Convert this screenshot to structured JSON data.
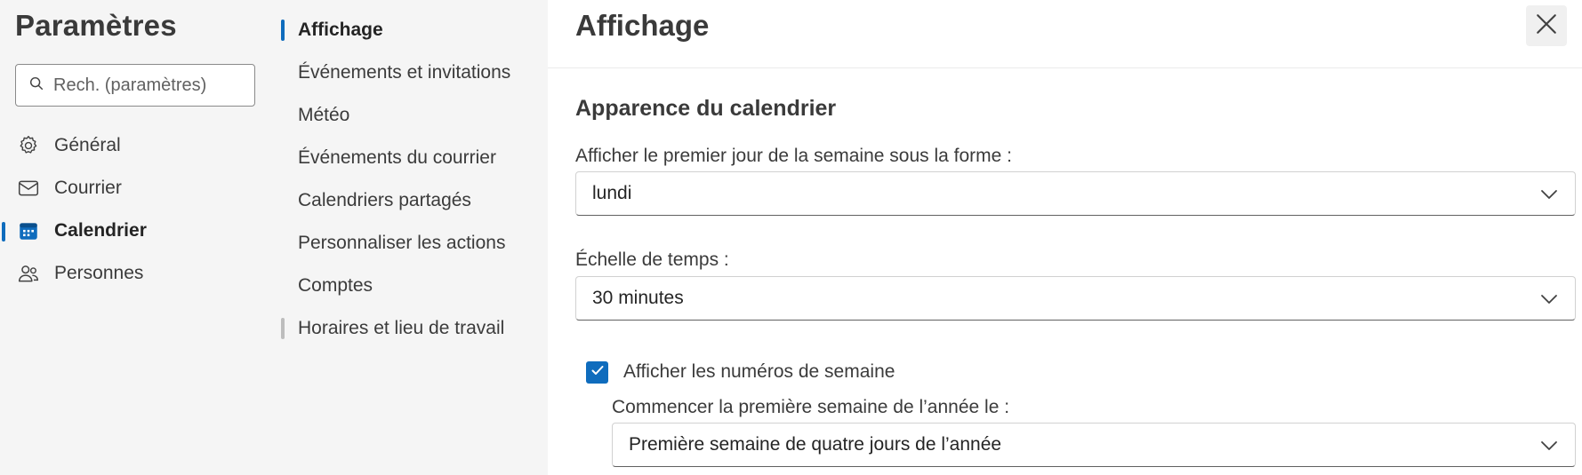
{
  "sidebar": {
    "title": "Paramètres",
    "search_placeholder": "Rech. (paramètres)",
    "items": [
      {
        "label": "Général",
        "icon": "gear-icon"
      },
      {
        "label": "Courrier",
        "icon": "mail-icon"
      },
      {
        "label": "Calendrier",
        "icon": "calendar-icon",
        "active": true
      },
      {
        "label": "Personnes",
        "icon": "people-icon"
      }
    ]
  },
  "subnav": {
    "items": [
      {
        "label": "Affichage",
        "active": true
      },
      {
        "label": "Événements et invitations"
      },
      {
        "label": "Météo"
      },
      {
        "label": "Événements du courrier"
      },
      {
        "label": "Calendriers partagés"
      },
      {
        "label": "Personnaliser les actions"
      },
      {
        "label": "Comptes"
      },
      {
        "label": "Horaires et lieu de travail"
      }
    ]
  },
  "content": {
    "title": "Affichage",
    "section_title": "Apparence du calendrier",
    "first_day_label": "Afficher le premier jour de la semaine sous la forme :",
    "first_day_value": "lundi",
    "time_scale_label": "Échelle de temps :",
    "time_scale_value": "30 minutes",
    "week_numbers_label": "Afficher les numéros de semaine",
    "week_numbers_checked": true,
    "first_week_label": "Commencer la première semaine de l’année le :",
    "first_week_value": "Première semaine de quatre jours de l’année"
  },
  "colors": {
    "accent": "#0f6cbd",
    "sidebar_bg": "#f5f5f5"
  }
}
